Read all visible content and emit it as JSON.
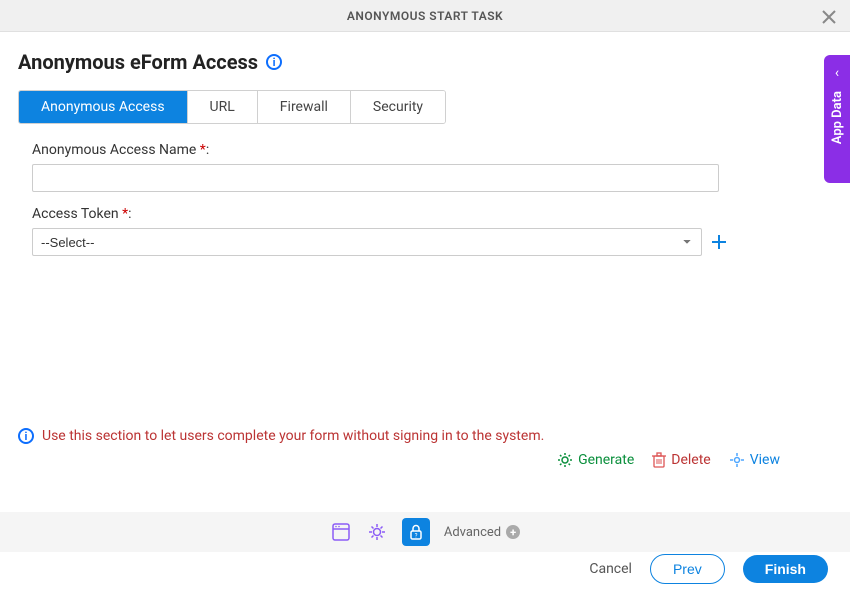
{
  "header": {
    "title": "ANONYMOUS START TASK"
  },
  "page": {
    "title": "Anonymous eForm Access"
  },
  "tabs": [
    {
      "label": "Anonymous Access"
    },
    {
      "label": "URL"
    },
    {
      "label": "Firewall"
    },
    {
      "label": "Security"
    }
  ],
  "form": {
    "name_label": "Anonymous Access Name",
    "name_req": " *",
    "name_colon": ":",
    "name_value": "",
    "token_label": "Access Token",
    "token_req": " *",
    "token_colon": ":",
    "token_selected": "--Select--"
  },
  "hint": {
    "text": "Use this section to let users complete your form without signing in to the system."
  },
  "actions": {
    "generate": "Generate",
    "delete": "Delete",
    "view": "View"
  },
  "toolbar": {
    "advanced": "Advanced"
  },
  "footer": {
    "cancel": "Cancel",
    "prev": "Prev",
    "finish": "Finish"
  },
  "side": {
    "label": "App Data"
  }
}
